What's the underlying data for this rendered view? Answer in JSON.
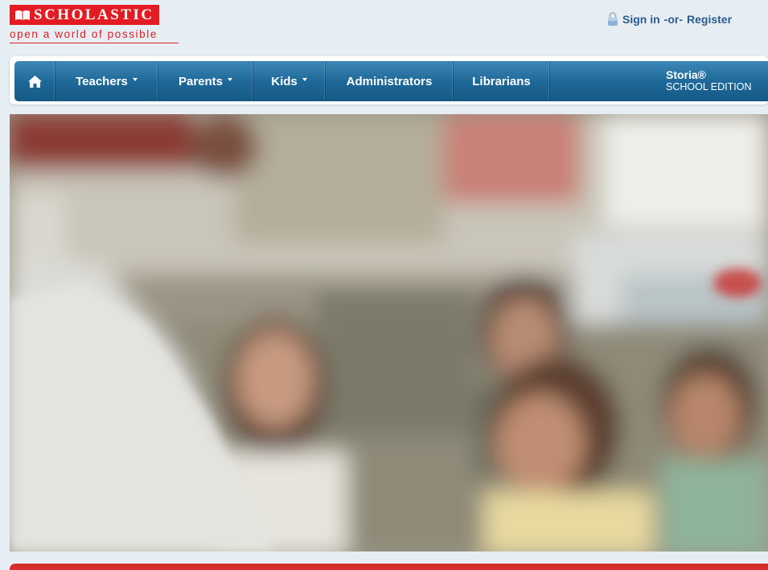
{
  "brand": {
    "logo_text": "SCHOLASTIC",
    "tagline": "open a world of possible",
    "brand_color": "#e31b23"
  },
  "account": {
    "sign_in": "Sign in",
    "separator": "-or-",
    "register": "Register",
    "icon": "lock-icon"
  },
  "nav": {
    "home_icon": "home-icon",
    "items": [
      {
        "label": "Teachers",
        "has_dropdown": true
      },
      {
        "label": "Parents",
        "has_dropdown": true
      },
      {
        "label": "Kids",
        "has_dropdown": true
      },
      {
        "label": "Administrators",
        "has_dropdown": false
      },
      {
        "label": "Librarians",
        "has_dropdown": false
      }
    ],
    "storia": {
      "name": "Storia®",
      "edition": "SCHOOL EDITION"
    },
    "bar_color": "#1d6796"
  },
  "hero": {
    "image": "classroom-children-photo"
  },
  "footer_strip_color": "#d62d2d"
}
